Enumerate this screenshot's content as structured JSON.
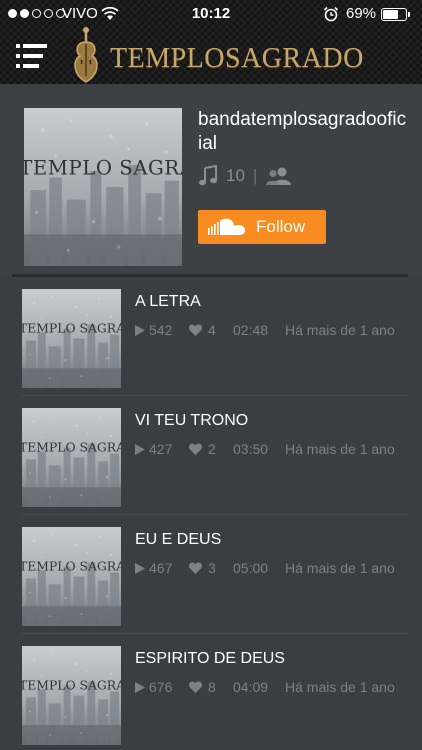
{
  "status_bar": {
    "carrier": "VIVO",
    "time": "10:12",
    "battery_percent": "69%",
    "signal_bars": 2,
    "battery_level": 0.69
  },
  "header": {
    "logo_text": "TEMPLOSAGRADO",
    "menu_icon": "hamburger-menu-icon"
  },
  "profile": {
    "artwork_text": "TEMPLO SAGRADO",
    "username": "bandatemplosagradooficial",
    "track_count": "10",
    "follow_label": "Follow",
    "accent_color": "#f98c21"
  },
  "tracks": [
    {
      "title": "A LETRA",
      "plays": "542",
      "likes": "4",
      "duration": "02:48",
      "age": "Há mais de 1 ano",
      "artwork_text": "TEMPLO SAGRADO"
    },
    {
      "title": "VI TEU TRONO",
      "plays": "427",
      "likes": "2",
      "duration": "03:50",
      "age": "Há mais de 1 ano",
      "artwork_text": "TEMPLO SAGRADO"
    },
    {
      "title": "EU E DEUS",
      "plays": "467",
      "likes": "3",
      "duration": "05:00",
      "age": "Há mais de 1 ano",
      "artwork_text": "TEMPLO SAGRADO"
    },
    {
      "title": "ESPIRITO DE DEUS",
      "plays": "676",
      "likes": "8",
      "duration": "04:09",
      "age": "Há mais de 1 ano",
      "artwork_text": "TEMPLO SAGRADO"
    }
  ]
}
